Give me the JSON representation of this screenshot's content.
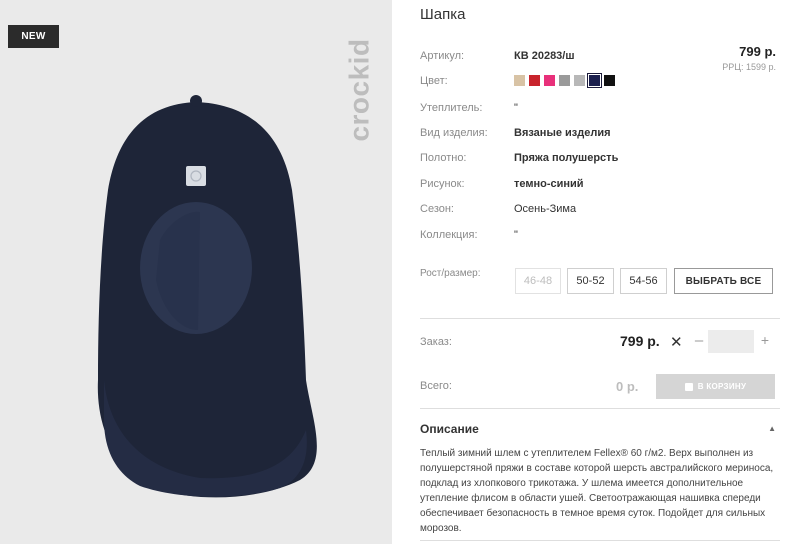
{
  "badge": "NEW",
  "brand": "crockid",
  "product": {
    "title": "Шапка",
    "price": "799 р.",
    "rrp": "РРЦ: 1599 р.",
    "attributes": [
      {
        "label": "Артикул:",
        "value": "КВ 20283/ш",
        "bold": true
      },
      {
        "label": "Цвет:",
        "value": ""
      },
      {
        "label": "Утеплитель:",
        "value": "\""
      },
      {
        "label": "Вид изделия:",
        "value": "Вязаные изделия",
        "bold": true
      },
      {
        "label": "Полотно:",
        "value": "Пряжа полушерсть",
        "bold": true
      },
      {
        "label": "Рисунок:",
        "value": "темно-синий",
        "bold": true
      },
      {
        "label": "Сезон:",
        "value": "Осень-Зима"
      },
      {
        "label": "Коллекция:",
        "value": "\""
      }
    ],
    "colors": [
      {
        "name": "beige",
        "hex": "#d8c3a5"
      },
      {
        "name": "red",
        "hex": "#c8232c"
      },
      {
        "name": "pink",
        "hex": "#e8307a"
      },
      {
        "name": "grey",
        "hex": "#9a9a9a"
      },
      {
        "name": "light-grey",
        "hex": "#b8b8b8"
      },
      {
        "name": "navy",
        "hex": "#1b1f4d",
        "selected": true
      },
      {
        "name": "black",
        "hex": "#111111"
      }
    ]
  },
  "sizes": {
    "label": "Рост/размер:",
    "options": [
      {
        "label": "46-48",
        "available": false
      },
      {
        "label": "50-52",
        "available": true
      },
      {
        "label": "54-56",
        "available": true
      }
    ],
    "select_all": "ВЫБРАТЬ ВСЕ"
  },
  "order": {
    "label": "Заказ:",
    "price": "799 р.",
    "times": "✕",
    "minus": "–",
    "quantity": "",
    "plus": "+"
  },
  "total": {
    "label": "Всего:",
    "value": "0 р.",
    "cart_button": "В КОРЗИНУ"
  },
  "description": {
    "title": "Описание",
    "toggle": "▲",
    "text": "Теплый зимний шлем с утеплителем Fellex® 60 г/м2. Верх выполнен из полушерстяной пряжи в составе которой шерсть австралийского мериноса, подклад из хлопкового трикотажа. У шлема имеется дополнительное утепление флисом в области ушей. Светоотражающая нашивка спереди обеспечивает безопасность в темное время суток. Подойдет для сильных морозов."
  }
}
